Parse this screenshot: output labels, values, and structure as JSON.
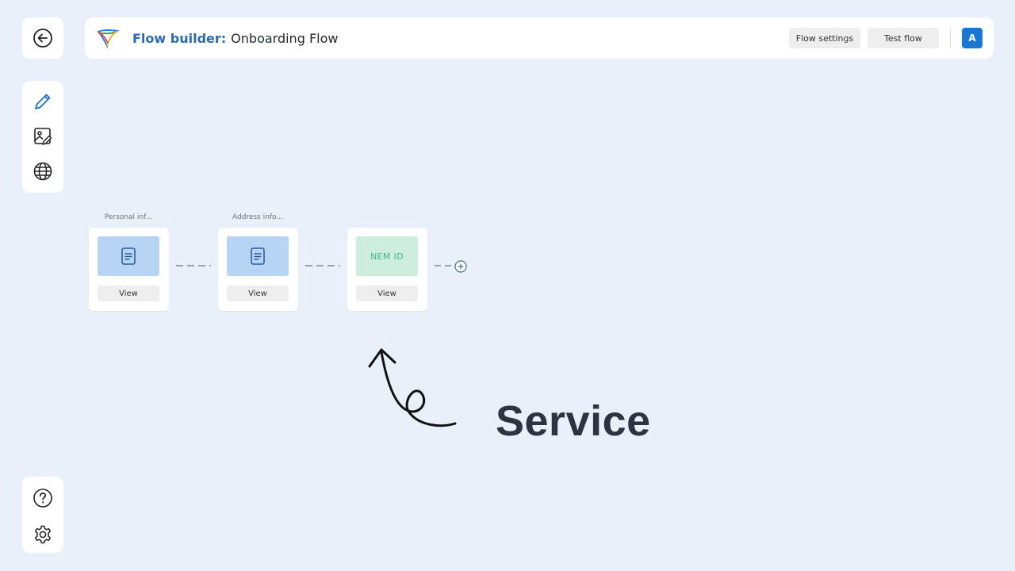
{
  "header": {
    "title_prefix": "Flow builder:",
    "title_name": "Onboarding Flow",
    "flow_settings_label": "Flow settings",
    "test_flow_label": "Test flow",
    "avatar_initial": "A"
  },
  "sidebar": {
    "top": [
      {
        "icon": "back-arrow-icon"
      }
    ],
    "tools": [
      {
        "icon": "pencil-icon"
      },
      {
        "icon": "image-edit-icon"
      },
      {
        "icon": "globe-icon"
      }
    ],
    "bottom": [
      {
        "icon": "help-icon"
      },
      {
        "icon": "gear-icon"
      }
    ]
  },
  "flow": {
    "steps": [
      {
        "label": "Personal inf...",
        "thumb": "document-icon",
        "button": "View"
      },
      {
        "label": "Address info...",
        "thumb": "document-icon",
        "button": "View"
      },
      {
        "label": "",
        "thumb_text": "NEM ID",
        "button": "View"
      }
    ],
    "add_step_icon": "plus-circle-icon"
  },
  "annotation": {
    "text": "Service"
  },
  "colors": {
    "background": "#e9f0fa",
    "brand_blue": "#2b6cb0",
    "avatar_blue": "#1976d2",
    "doc_thumb": "#b7d4f4",
    "nem_thumb": "#cdeedc",
    "nem_text": "#41b88a"
  }
}
